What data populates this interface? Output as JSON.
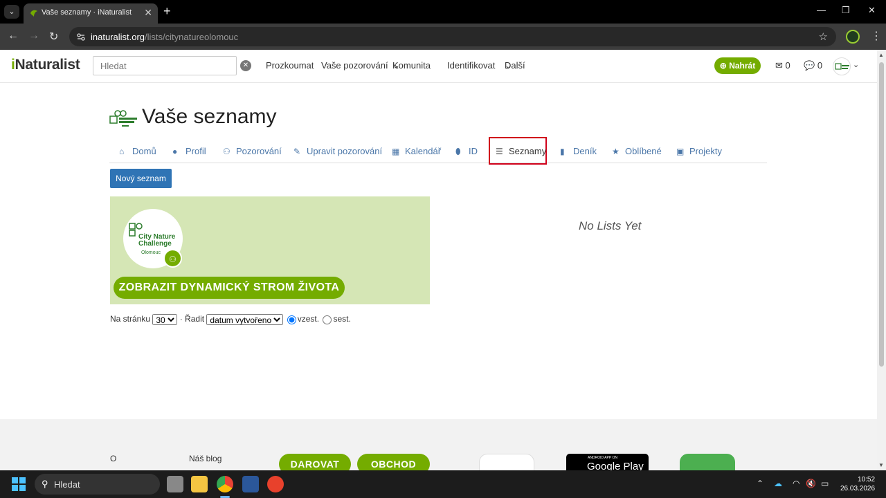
{
  "browser": {
    "tab_title": "Vaše seznamy · iNaturalist",
    "url_domain": "inaturalist.org",
    "url_path": "/lists/citynatureolomouc"
  },
  "header": {
    "logo_first": "i",
    "logo_rest": "Naturalist",
    "search_placeholder": "Hledat",
    "nav": [
      "Prozkoumat",
      "Vaše pozorování",
      "Komunita",
      "Identifikovat",
      "Další"
    ],
    "upload_label": "Nahrát",
    "messages_count": "0",
    "notifications_count": "0"
  },
  "main": {
    "title": "Vaše seznamy",
    "tabs": [
      {
        "label": "Domů",
        "icon": "home-icon"
      },
      {
        "label": "Profil",
        "icon": "user-icon"
      },
      {
        "label": "Pozorování",
        "icon": "binoculars-icon"
      },
      {
        "label": "Upravit pozorování",
        "icon": "pencil-icon"
      },
      {
        "label": "Kalendář",
        "icon": "calendar-icon"
      },
      {
        "label": "ID",
        "icon": "tag-icon"
      },
      {
        "label": "Seznamy",
        "icon": "list-icon"
      },
      {
        "label": "Deník",
        "icon": "book-icon"
      },
      {
        "label": "Oblíbené",
        "icon": "star-icon"
      },
      {
        "label": "Projekty",
        "icon": "briefcase-icon"
      }
    ],
    "active_tab": "Seznamy",
    "new_list_label": "Nový seznam",
    "banner_badge_lines": [
      "City Nature",
      "Challenge"
    ],
    "banner_badge_sub": "Olomouc",
    "tree_button_label": "ZOBRAZIT DYNAMICKÝ STROM ŽIVOTA",
    "empty_state": "No Lists Yet",
    "pager": {
      "per_page_label": "Na stránku",
      "per_page_value": "30",
      "sort_label": "· Řadit",
      "sort_value": "datum vytvořeno",
      "asc_label": "vzest.",
      "desc_label": "sest."
    }
  },
  "footer": {
    "about": "O",
    "blog": "Náš blog",
    "donate": "DAROVAT",
    "shop": "OBCHOD",
    "gplay_small": "ANDROID APP ON",
    "gplay_big": "Google Play"
  },
  "taskbar": {
    "search_label": "Hledat",
    "time": "10:52",
    "date": "26.03.2026"
  },
  "colors": {
    "brand_green": "#74ac00",
    "link_blue": "#4a76a8",
    "button_blue": "#2f74b5",
    "highlight_red": "#d0021b"
  }
}
